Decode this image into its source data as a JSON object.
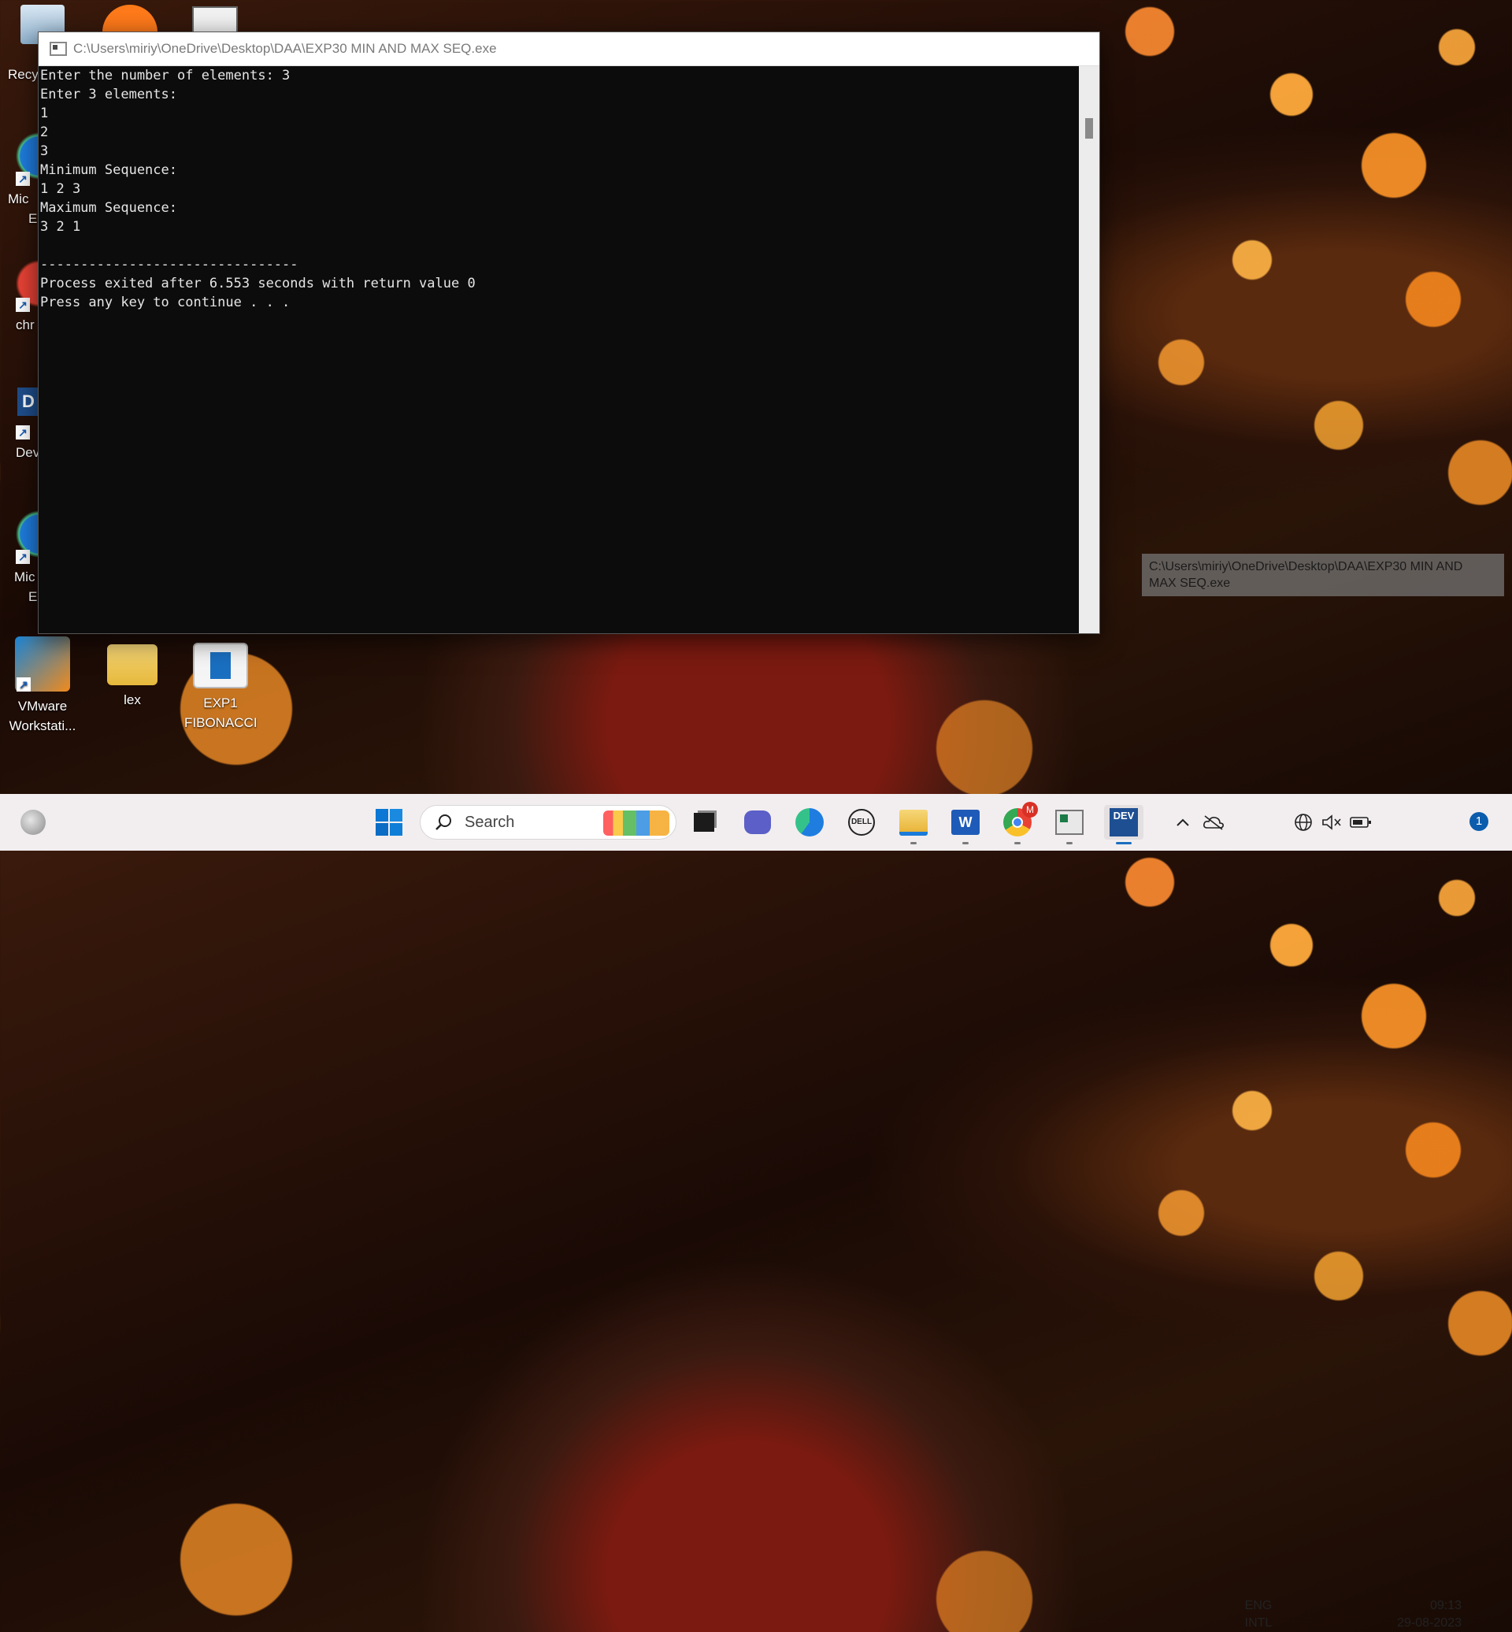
{
  "desktop": {
    "left_labels": [
      "Recy",
      "Mic",
      "E",
      "chr",
      "Dev",
      "Mic",
      "E"
    ],
    "bottom_icons": [
      {
        "label_line1": "VMware",
        "label_line2": "Workstati..."
      },
      {
        "label_line1": "lex",
        "label_line2": ""
      },
      {
        "label_line1": "EXP1",
        "label_line2": "FIBONACCI"
      }
    ]
  },
  "console": {
    "title": "C:\\Users\\miriy\\OneDrive\\Desktop\\DAA\\EXP30 MIN AND MAX SEQ.exe",
    "lines": [
      "Enter the number of elements: 3",
      "Enter 3 elements:",
      "1",
      "2",
      "3",
      "Minimum Sequence:",
      "1 2 3",
      "Maximum Sequence:",
      "3 2 1",
      "",
      "--------------------------------",
      "Process exited after 6.553 seconds with return value 0",
      "Press any key to continue . . ."
    ]
  },
  "tooltip": {
    "line1": "C:\\Users\\miriy\\OneDrive\\Desktop\\DAA\\EXP30 MIN AND",
    "line2": "MAX SEQ.exe"
  },
  "taskbar": {
    "search_placeholder": "Search",
    "language_line1": "ENG",
    "language_line2": "INTL",
    "time": "09:13",
    "date": "29-08-2023",
    "notification_count": "1",
    "chrome_badge": "M",
    "icons": [
      "weather-icon",
      "windows-start-icon",
      "search-icon",
      "task-view-icon",
      "chat-icon",
      "edge-icon",
      "dell-icon",
      "file-explorer-icon",
      "word-icon",
      "chrome-icon",
      "console-app-icon",
      "devcpp-icon",
      "tray-chevron-icon",
      "onedrive-icon",
      "network-icon",
      "volume-muted-icon",
      "battery-icon"
    ]
  }
}
